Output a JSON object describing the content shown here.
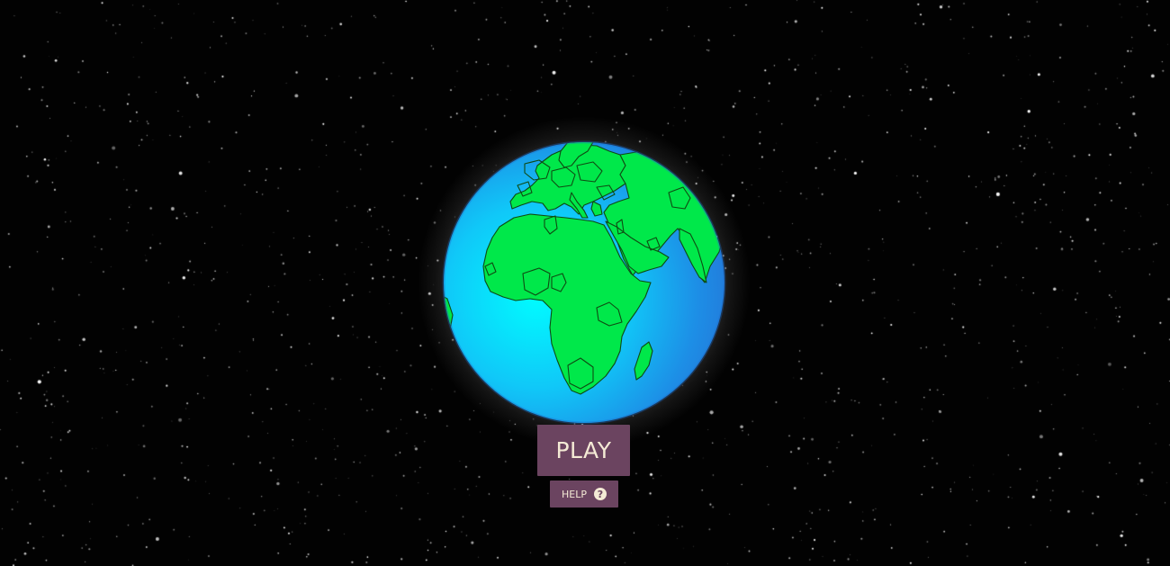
{
  "menu": {
    "play_label": "PLAY",
    "help_label": "HELP",
    "help_icon": "question-circle-icon"
  },
  "scene": {
    "background": "starfield",
    "globe_view": "earth-africa-europe",
    "colors": {
      "space": "#020202",
      "ocean_light": "#00f0ff",
      "ocean_dark": "#1a7fe0",
      "land": "#00e84a",
      "button": "#6b4460",
      "button_text": "#f4ead5"
    }
  }
}
